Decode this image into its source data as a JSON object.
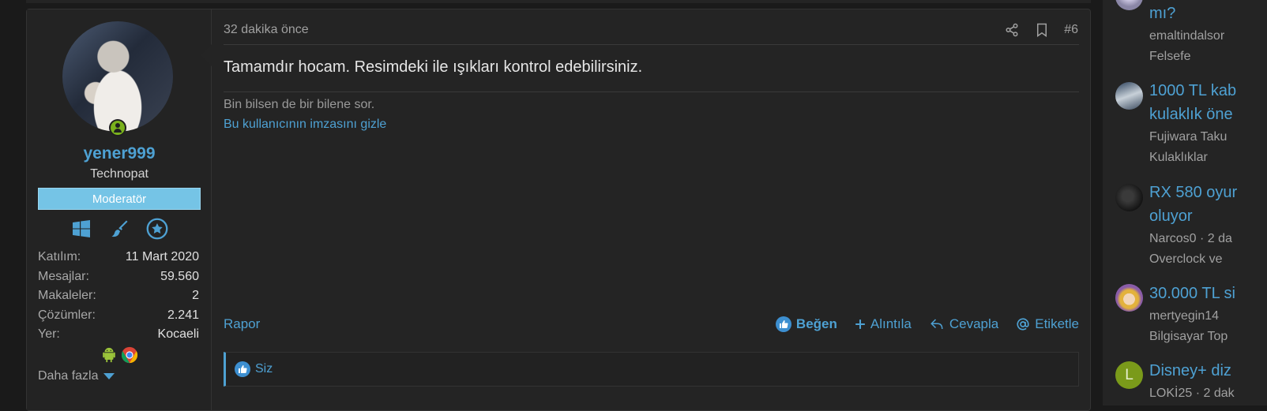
{
  "post": {
    "user": {
      "name": "yener999",
      "title": "Technopat",
      "role_banner": "Moderatör",
      "stats": [
        {
          "label": "Katılım:",
          "value": "11 Mart 2020"
        },
        {
          "label": "Mesajlar:",
          "value": "59.560"
        },
        {
          "label": "Makaleler:",
          "value": "2"
        },
        {
          "label": "Çözümler:",
          "value": "2.241"
        },
        {
          "label": "Yer:",
          "value": "Kocaeli"
        }
      ],
      "more_label": "Daha fazla"
    },
    "time": "32 dakika önce",
    "post_number": "#6",
    "body": "Tamamdır hocam. Resimdeki ile ışıkları kontrol edebilirsiniz.",
    "signature": "Bin bilsen de bir bilene sor.",
    "hide_signature": "Bu kullanıcının imzasını gizle",
    "actions": {
      "report": "Rapor",
      "like": "Beğen",
      "quote": "Alıntıla",
      "reply": "Cevapla",
      "tag": "Etiketle"
    },
    "likes_text": "Siz"
  },
  "sidebar": {
    "items": [
      {
        "title_lines": [
          "mı?"
        ],
        "meta_lines": [
          "emaltindalsor",
          "Felsefe"
        ]
      },
      {
        "title_lines": [
          "1000 TL kab",
          "kulaklık öne"
        ],
        "meta_lines": [
          "Fujiwara Taku",
          "Kulaklıklar"
        ]
      },
      {
        "title_lines": [
          "RX 580 oyur",
          "oluyor"
        ],
        "meta_lines": [
          "Narcos0 · 2 da",
          "Overclock ve"
        ]
      },
      {
        "title_lines": [
          "30.000 TL si"
        ],
        "meta_lines": [
          "mertyegin14",
          "Bilgisayar Top"
        ]
      },
      {
        "title_lines": [
          "Disney+ diz"
        ],
        "meta_lines": [
          "LOKİ25 · 2 dak"
        ],
        "avatar_letter": "L"
      }
    ]
  },
  "colors": {
    "accent": "#4ea1d3",
    "role_banner": "#75c4e6",
    "online": "#7ab11d",
    "letter_avatar": "#7a9a1a"
  }
}
